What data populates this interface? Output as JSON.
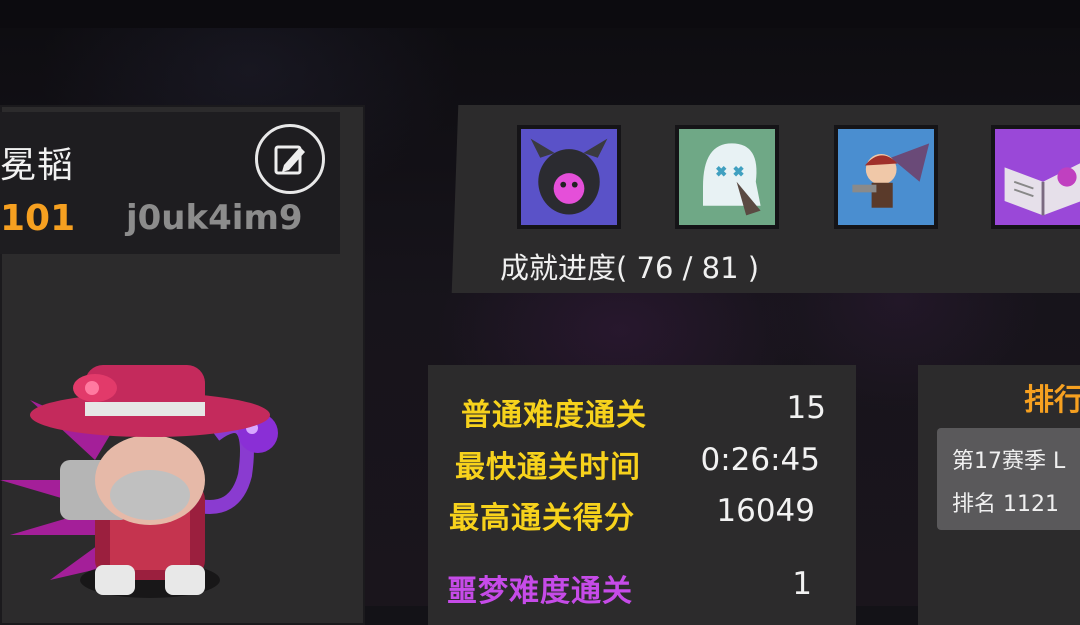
{
  "profile": {
    "name": "冕韬",
    "level": "101",
    "player_id": "j0uk4im9"
  },
  "achievements": {
    "label": "成就进度( 76 / 81 )",
    "icons": [
      "demon-shield-icon",
      "ghost-creature-icon",
      "winged-warrior-icon",
      "spellbook-icon"
    ]
  },
  "stats": {
    "normal_clear_label": "普通难度通关",
    "normal_clear_value": "15",
    "fastest_time_label": "最快通关时间",
    "fastest_time_value": "0:26:45",
    "high_score_label": "最高通关得分",
    "high_score_value": "16049",
    "nightmare_clear_label": "噩梦难度通关",
    "nightmare_clear_value": "1"
  },
  "ranking": {
    "title": "排行",
    "season": "第17赛季 L",
    "rank": "排名 1121"
  },
  "colors": {
    "accent_orange": "#f6a020",
    "label_yellow": "#f7d21c",
    "nightmare_purple": "#c64be8",
    "panel": "#2c2b2c"
  }
}
